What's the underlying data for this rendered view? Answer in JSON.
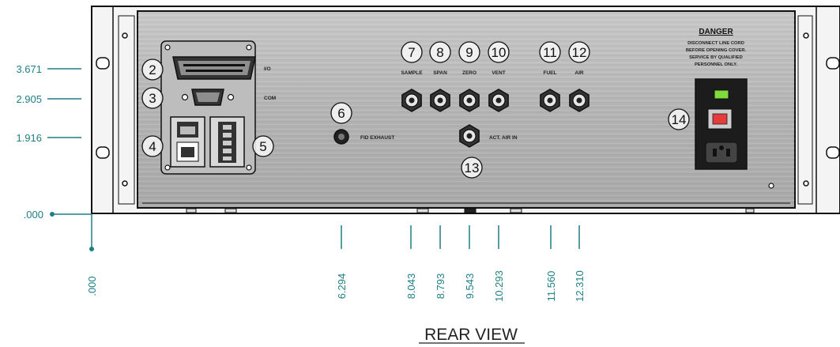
{
  "colors": {
    "dimension": "#1f7e86",
    "panel": "#b8b8b8",
    "chassis": "#f4f4f4",
    "outline": "#111111"
  },
  "vertical_dimensions": [
    "3.671",
    "2.905",
    "1.916",
    ".000"
  ],
  "horizontal_dimensions": [
    ".000",
    "6.294",
    "8.043",
    "8.793",
    "9.543",
    "10.293",
    "11.560",
    "12.310"
  ],
  "callouts": [
    "2",
    "3",
    "4",
    "5",
    "6",
    "7",
    "8",
    "9",
    "10",
    "11",
    "12",
    "13",
    "14"
  ],
  "labels": {
    "io": "I/O",
    "com": "COM",
    "fid_exhaust": "FID EXHAUST",
    "act_air_in": "ACT. AIR IN",
    "sample": "SAMPLE",
    "span": "SPAN",
    "zero": "ZERO",
    "vent": "VENT",
    "fuel": "FUEL",
    "air": "AIR"
  },
  "danger": {
    "title": "DANGER",
    "lines": [
      "DISCONNECT LINE CORD",
      "BEFORE OPENING COVER.",
      "SERVICE BY QUALIFIED",
      "PERSONNEL ONLY."
    ]
  },
  "caption": "REAR VIEW",
  "icons": [
    "db25-connector-icon",
    "db9-connector-icon",
    "ethernet-jack-icon",
    "terminal-block-icon",
    "fitting-icon",
    "power-inlet-icon",
    "power-switch-icon"
  ]
}
